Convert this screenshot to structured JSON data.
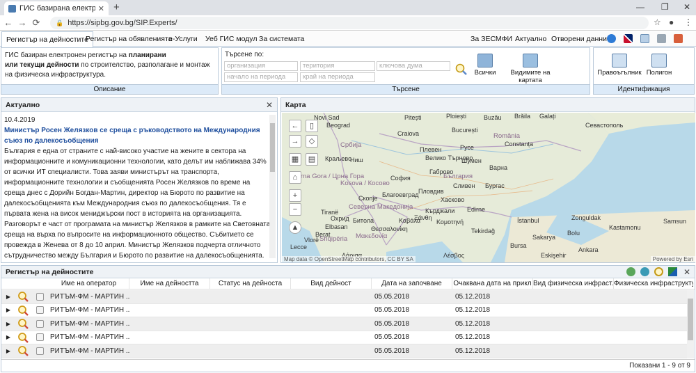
{
  "browser": {
    "tab_title": "ГИС базирана електронна плат",
    "url": "https://sipbg.gov.bg/SIP.Experts/"
  },
  "nav": {
    "items": [
      "Регистър на дейностите",
      "Регистър на обявленията",
      "е-Услуги",
      "Уеб ГИС модул",
      "За системата"
    ],
    "right": [
      "За ЗЕСМФИ",
      "Актуално",
      "Отворени данни"
    ]
  },
  "ribbon": {
    "desc_line1": "ГИС базиран електронен регистър на ",
    "desc_bold1": "планирани",
    "desc_bold2": "или текущи дейности",
    "desc_line2": " по строителство, разполагане и монтаж",
    "desc_line3": "на физическа инфраструктура.",
    "desc_footer": "Описание",
    "search_label": "Търсене по:",
    "placeholders": {
      "organization": "организация",
      "territory": "територия",
      "keyword": "ключова дума",
      "period_start": "начало на периода",
      "period_end": "край на периода"
    },
    "btn_all": "Всички",
    "btn_visible": "Видимите на картата",
    "search_footer": "Търсене",
    "btn_rect": "Правоъгълник",
    "btn_polygon": "Полигон",
    "ident_footer": "Идентификация"
  },
  "news": {
    "title": "Актуално",
    "date": "10.4.2019",
    "headline": "Министър Росен Желязков се среща с ръководството на Международния съюз по далекосъобщения",
    "body": "България е една от страните с най-високо участие на жените в сектора на информационните и комуникационни технологии, като делът им наближава 34% от всички ИТ специалисти. Това заяви министърът на транспорта, информационните технологии и съобщенията Росен Желязков по време на среща днес с Дорийн Богдан-Мартин, директор на Бюрото по развитие на далекосъобщенията към Международния съюз по далекосъобщения. Тя е първата жена на висок мениджърски пост в историята на организацията. Разговорът е част от програмата на министър Желязков в рамките на Световната среща на върха по въпросите на информационното общество. Събитието се провежда в Женева от 8 до 10 април. Министър Желязков подчерта отличното сътрудничество между България и Бюрото по развитие на далекосъобщенията. Като добри примери за това, българският министър посочи инициативите на страната ни за защита на"
  },
  "map": {
    "title": "Карта",
    "attribution": "Map data © OpenStreetMap contributors, CC BY SA",
    "powered": "Powered by Esri",
    "labels": {
      "novi_sad": "Novi Sad",
      "beograd": "Beograd",
      "srbija": "Србија",
      "kraljevo": "Краљево",
      "nis": "Ниш",
      "crna_gora": "Crna Gora / Црна Гора",
      "kosova": "Kosova / Косово",
      "severna_makedonija": "Северна Македонија",
      "skopje": "Скопје",
      "bitola": "Битола",
      "ohrid": "Охрид",
      "tirane": "Tiranë",
      "elbasan": "Elbasan",
      "berat": "Berat",
      "vlore": "Vlorë",
      "shqiperia": "Shqipëria",
      "lecce": "Lecce",
      "craiova": "Craiova",
      "pitesti": "Pitești",
      "ploiesti": "Ploiești",
      "bucuresti": "București",
      "buzau": "Buzău",
      "braila": "Brăila",
      "galati": "Galați",
      "romania": "România",
      "constanta": "Constanța",
      "sofia": "София",
      "pleven": "Плевен",
      "ruse": "Русе",
      "veliko_tarnovo": "Велико Търново",
      "shumen": "Шумен",
      "varna": "Варна",
      "bulgaria": "България",
      "gabrovo": "Габрово",
      "sliven": "Сливен",
      "burgas": "Бургас",
      "plovdiv": "Пловдив",
      "blagoevgrad": "Благоевград",
      "haskovo": "Хасково",
      "edirne": "Edirne",
      "kardzhali": "Кърджали",
      "thessaloniki": "Θεσσαλονίκη",
      "makedonia": "Μακεδονία",
      "kavala": "Καβάλα",
      "xanthi": "Ξάνθη",
      "komotini": "Κομοτηνή",
      "tekirdag": "Tekirdağ",
      "istanbul": "İstanbul",
      "sakarya": "Sakarya",
      "bursa": "Bursa",
      "bolu": "Bolu",
      "ankara": "Ankara",
      "kastamonu": "Kastamonu",
      "zonguldak": "Zonguldak",
      "samsun": "Samsun",
      "sevastopol": "Севастополь",
      "larissa": "Λάρισα",
      "lesvos": "Λέσβος",
      "eskisehir": "Eskişehir"
    }
  },
  "grid": {
    "title": "Регистър на дейностите",
    "columns": [
      "Име на оператор",
      "Име на дейността",
      "Статус на дейноста",
      "Вид дейност",
      "Дата на започване",
      "Очаквана дата на прикл",
      "Вид физическа инфраст...",
      "Физическа инфраструкту..."
    ],
    "rows": [
      {
        "operator": "РИТЪМ-ФМ - МАРТИН ...",
        "start": "05.05.2018",
        "end": "05.12.2018"
      },
      {
        "operator": "РИТЪМ-ФМ - МАРТИН ...",
        "start": "05.05.2018",
        "end": "05.12.2018"
      },
      {
        "operator": "РИТЪМ-ФМ - МАРТИН ...",
        "start": "05.05.2018",
        "end": "05.12.2018"
      },
      {
        "operator": "РИТЪМ-ФМ - МАРТИН ...",
        "start": "05.05.2018",
        "end": "05.12.2018"
      },
      {
        "operator": "РИТЪМ-ФМ - МАРТИН ...",
        "start": "05.05.2018",
        "end": "05.12.2018"
      }
    ],
    "footer": "Показани 1 - 9 от 9"
  },
  "colors": {
    "accent": "#1f4f9e",
    "panel_border": "#b9c9d9",
    "ribbon_footer": "#dceaf8"
  }
}
